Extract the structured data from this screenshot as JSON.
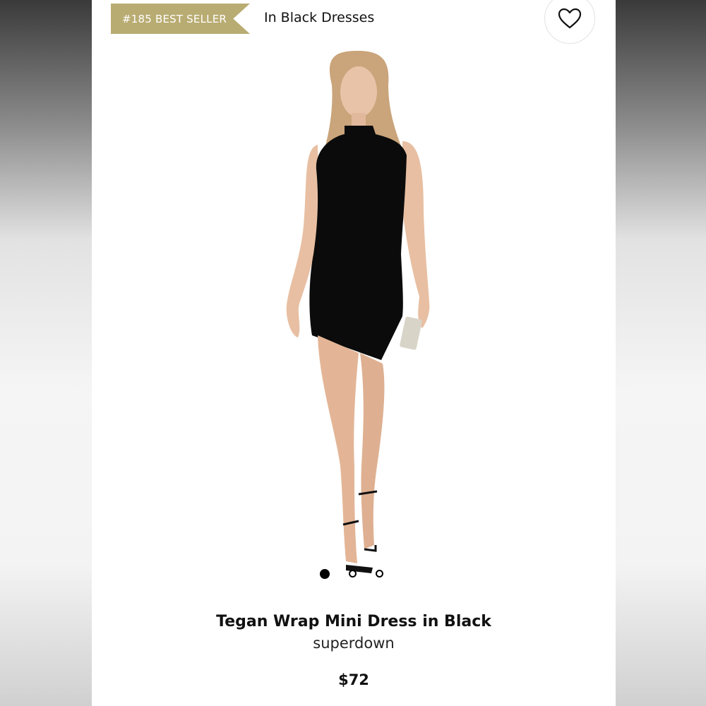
{
  "badge": {
    "label": "#185 BEST SELLER",
    "color": "#b9ac72"
  },
  "category": {
    "label": "In Black Dresses"
  },
  "favorite": {
    "icon": "heart-outline-icon"
  },
  "product": {
    "image": "product-photo",
    "carousel": {
      "total": 3,
      "current": 1
    },
    "title": "Tegan Wrap Mini Dress in Black",
    "brand": "superdown",
    "price": "$72"
  }
}
